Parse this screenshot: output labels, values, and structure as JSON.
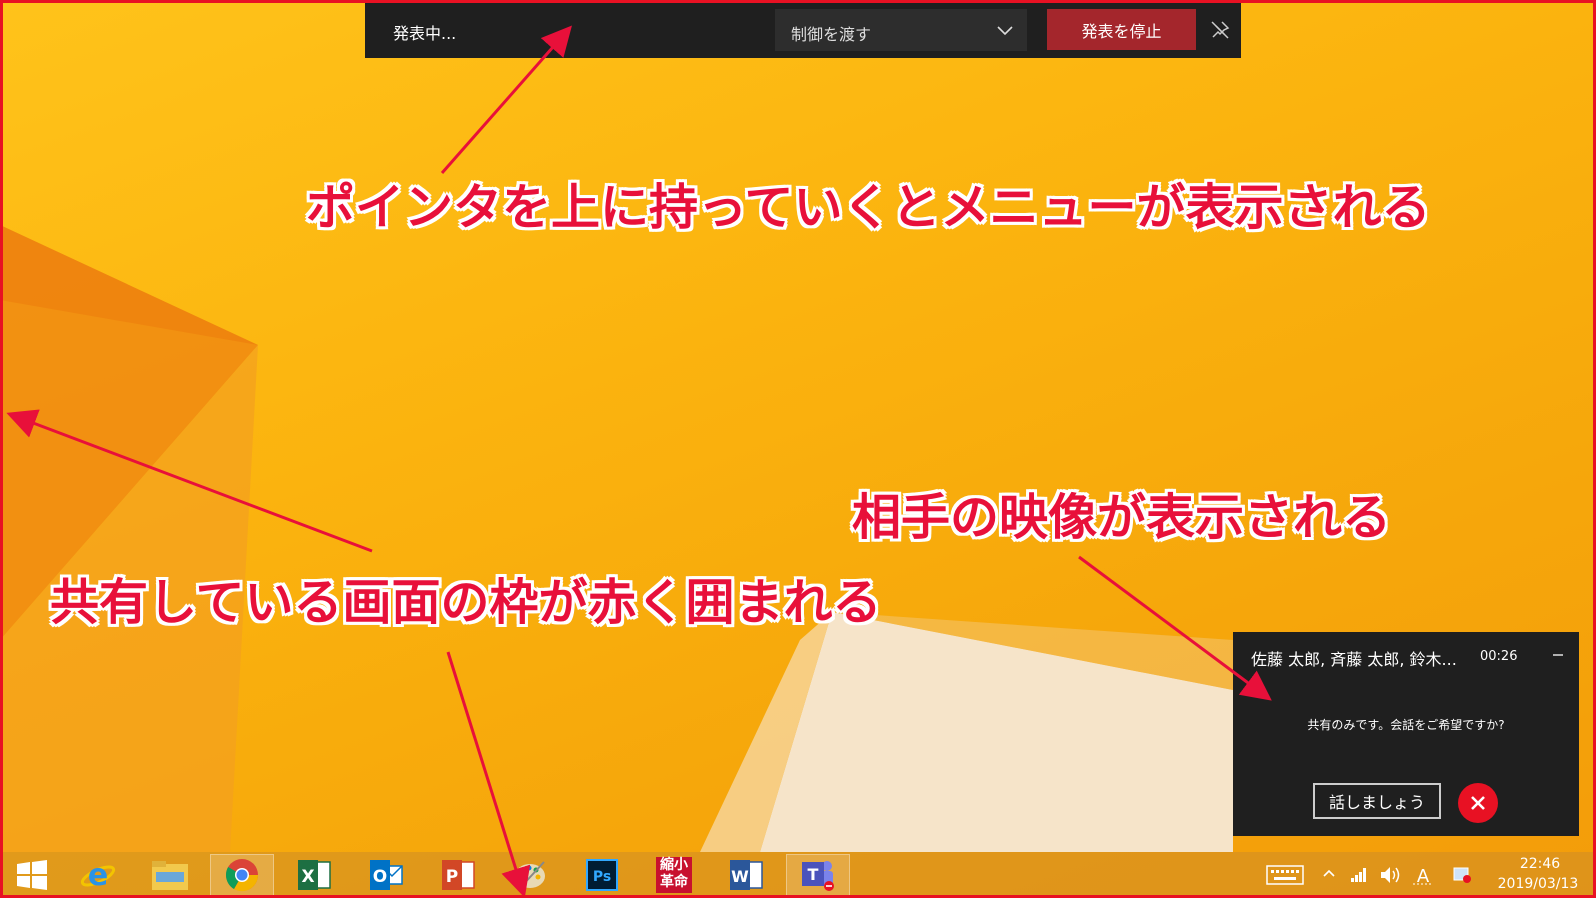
{
  "presenter_bar": {
    "status": "発表中...",
    "give_control_label": "制御を渡す",
    "stop_presenting_label": "発表を停止"
  },
  "annotations": {
    "pointer_menu": "ポインタを上に持っていくとメニューが表示される",
    "partner_video": "相手の映像が表示される",
    "red_border": "共有している画面の枠が赤く囲まれる"
  },
  "call_monitor": {
    "participants": "佐藤 太郎, 斉藤 太郎, 鈴木...",
    "timer": "00:26",
    "message": "共有のみです。会話をご希望ですか?",
    "lets_talk_label": "話しましょう"
  },
  "taskbar": {
    "apps": [
      "start",
      "internet-explorer",
      "file-explorer",
      "chrome",
      "excel",
      "outlook",
      "powerpoint",
      "paint",
      "photoshop",
      "shukusho-kakumei",
      "word",
      "teams"
    ],
    "shukusho_label_1": "縮小",
    "shukusho_label_2": "革命",
    "clock_time": "22:46",
    "clock_date": "2019/03/13"
  },
  "colors": {
    "accent_red": "#e81123",
    "stop_button": "#a4262c",
    "annotation_text": "#e8103a",
    "bar_background": "#1f1f1f"
  }
}
